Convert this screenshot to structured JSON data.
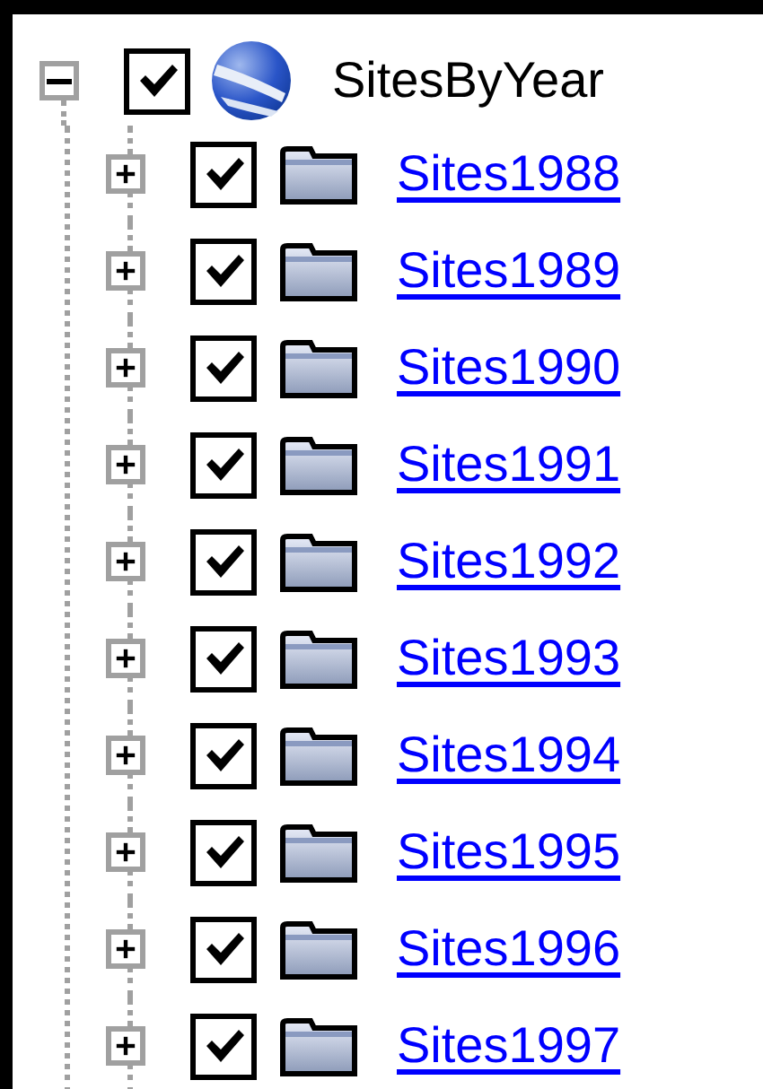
{
  "tree": {
    "label": "SitesByYear",
    "kind": "globe",
    "link": false,
    "checked": true,
    "expanded": true,
    "children": [
      {
        "label": "Sites1988",
        "kind": "folder",
        "link": true,
        "checked": true,
        "expanded": false
      },
      {
        "label": "Sites1989",
        "kind": "folder",
        "link": true,
        "checked": true,
        "expanded": false
      },
      {
        "label": "Sites1990",
        "kind": "folder",
        "link": true,
        "checked": true,
        "expanded": false
      },
      {
        "label": "Sites1991",
        "kind": "folder",
        "link": true,
        "checked": true,
        "expanded": false
      },
      {
        "label": "Sites1992",
        "kind": "folder",
        "link": true,
        "checked": true,
        "expanded": false
      },
      {
        "label": "Sites1993",
        "kind": "folder",
        "link": true,
        "checked": true,
        "expanded": false
      },
      {
        "label": "Sites1994",
        "kind": "folder",
        "link": true,
        "checked": true,
        "expanded": false
      },
      {
        "label": "Sites1995",
        "kind": "folder",
        "link": true,
        "checked": true,
        "expanded": false
      },
      {
        "label": "Sites1996",
        "kind": "folder",
        "link": true,
        "checked": true,
        "expanded": false
      },
      {
        "label": "Sites1997",
        "kind": "folder",
        "link": true,
        "checked": true,
        "expanded": false
      }
    ]
  }
}
